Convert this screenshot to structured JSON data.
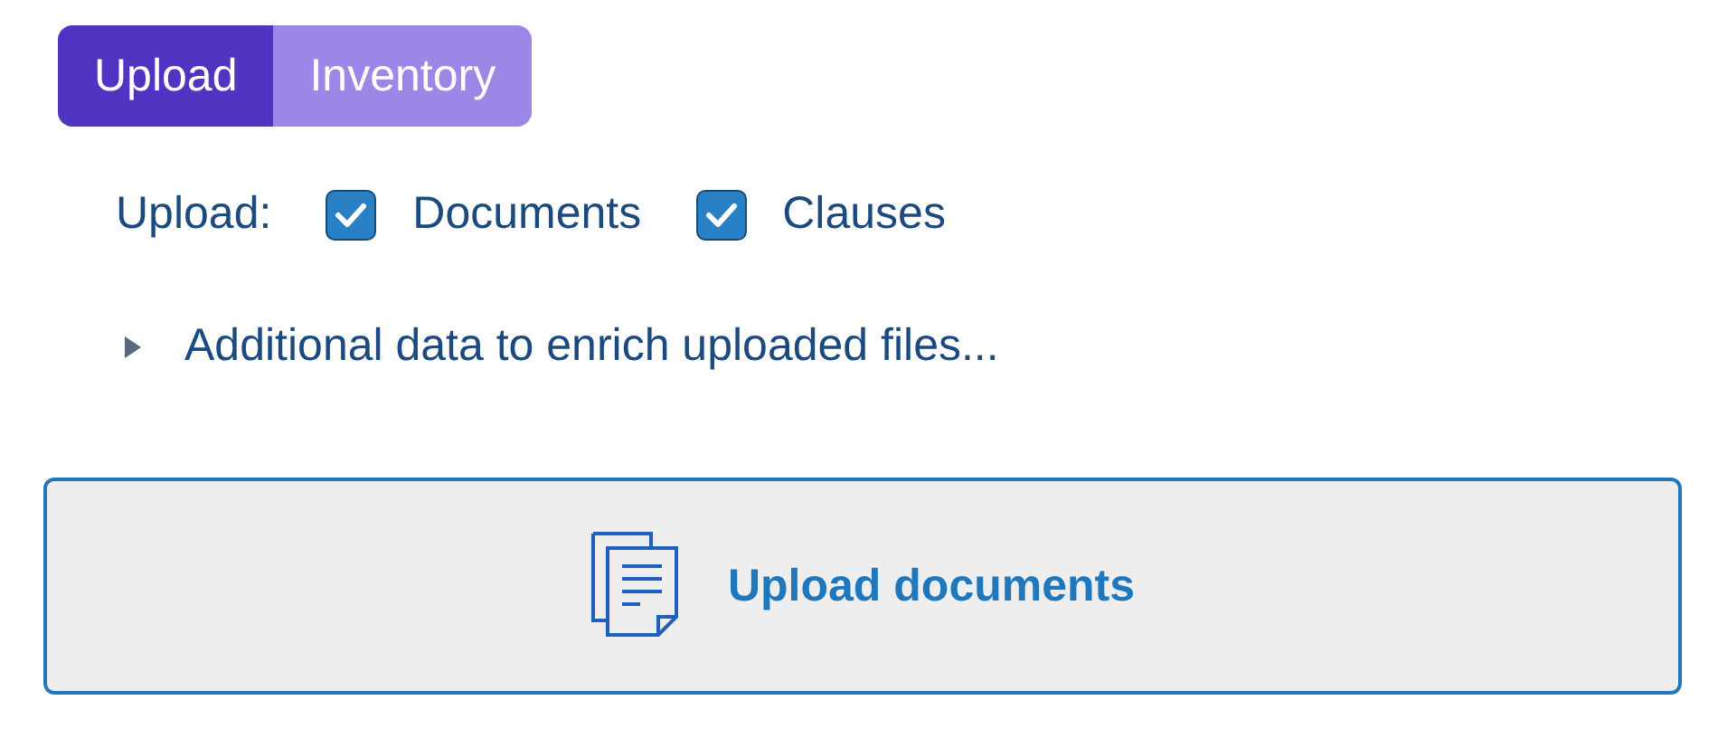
{
  "tabs": [
    {
      "label": "Upload",
      "selected": true
    },
    {
      "label": "Inventory",
      "selected": false
    }
  ],
  "upload_options": {
    "label": "Upload:",
    "options": [
      {
        "label": "Documents",
        "checked": true
      },
      {
        "label": "Clauses",
        "checked": true
      }
    ]
  },
  "additional_data": {
    "label": "Additional data to enrich uploaded files...",
    "expanded": false
  },
  "upload_button": {
    "label": "Upload documents"
  }
}
